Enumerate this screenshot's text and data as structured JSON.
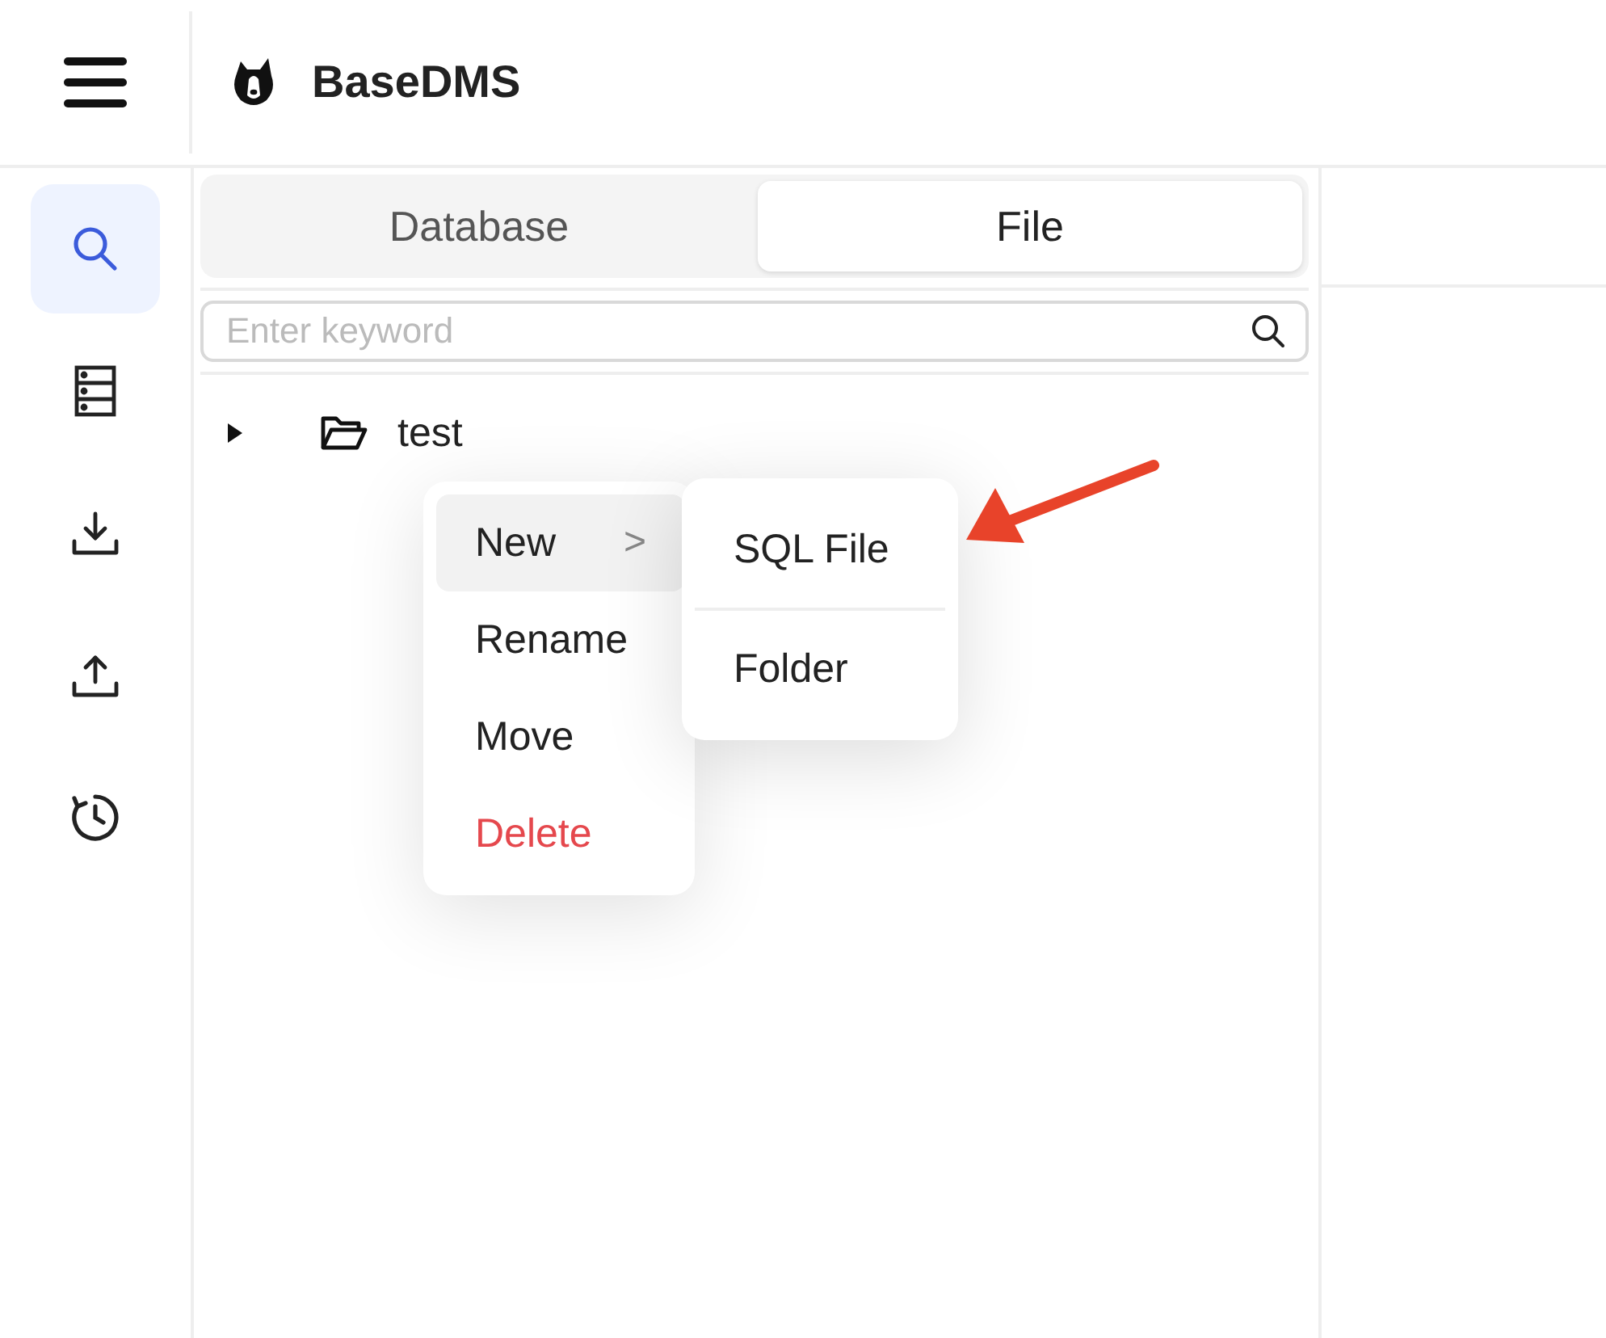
{
  "header": {
    "title": "BaseDMS"
  },
  "sidebar": {
    "items": [
      {
        "kind": "search",
        "selected": true
      },
      {
        "kind": "database",
        "selected": false
      },
      {
        "kind": "download",
        "selected": false
      },
      {
        "kind": "upload",
        "selected": false
      },
      {
        "kind": "history",
        "selected": false
      }
    ]
  },
  "tabs": [
    {
      "label": "Database",
      "selected": false
    },
    {
      "label": "File",
      "selected": true
    }
  ],
  "search": {
    "placeholder": "Enter keyword"
  },
  "tree": [
    {
      "label": "test",
      "expanded": false
    }
  ],
  "context_menu": {
    "items": [
      {
        "label": "New",
        "kind": "submenu",
        "selected": true,
        "arrow": ">"
      },
      {
        "label": "Rename",
        "kind": "normal",
        "selected": false
      },
      {
        "label": "Move",
        "kind": "normal",
        "selected": false
      },
      {
        "label": "Delete",
        "kind": "danger",
        "selected": false
      }
    ],
    "submenu": [
      {
        "label": "SQL File",
        "kind": "item"
      },
      {
        "kind": "separator"
      },
      {
        "label": "Folder",
        "kind": "item"
      }
    ]
  }
}
